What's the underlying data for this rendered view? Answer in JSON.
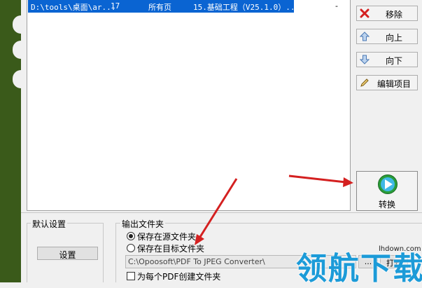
{
  "file_list": {
    "selected_row": {
      "path": "D:\\tools\\桌面\\ar...",
      "pages_count": "17",
      "page_range": "所有页",
      "name": "15.基础工程（V25.1.0）..."
    },
    "dash": "-"
  },
  "side_buttons": {
    "remove": "移除",
    "up": "向上",
    "down": "向下",
    "edit": "编辑项目"
  },
  "convert_button": "转换",
  "default_settings": {
    "title": "默认设置",
    "button": "设置"
  },
  "output_folder": {
    "title": "输出文件夹",
    "radio_source": "保存在源文件夹",
    "radio_target": "保存在目标文件夹",
    "selected": "source",
    "path_value": "C:\\Opoosoft\\PDF To JPEG Converter\\",
    "browse_button": "...",
    "open_button": "打开",
    "checkbox_label": "为每个PDF创建文件夹",
    "checkbox_checked": false
  },
  "watermark": {
    "text": "领航下载",
    "url": "lhdown.com"
  },
  "colors": {
    "selection": "#0a64d2",
    "annotation_arrow": "#d42020",
    "convert_icon": "#2a9d3a",
    "watermark": "#1c9bd8"
  },
  "icons": {
    "remove": "red-x-icon",
    "up": "up-arrow-icon",
    "down": "down-arrow-icon",
    "edit": "pencil-icon",
    "convert": "green-play-icon"
  }
}
